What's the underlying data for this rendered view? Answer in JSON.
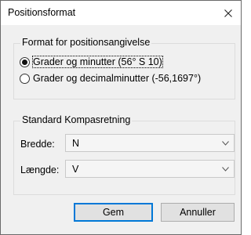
{
  "window": {
    "title": "Positionsformat",
    "close_icon": "close-icon"
  },
  "format_group": {
    "legend": "Format for positionsangivelse",
    "options": [
      {
        "label": "Grader og minutter (56° S 10)",
        "selected": true
      },
      {
        "label": "Grader og decimalminutter (-56,1697°)",
        "selected": false
      }
    ]
  },
  "compass_group": {
    "legend": "Standard Kompasretning",
    "latitude": {
      "label": "Bredde:",
      "value": "N"
    },
    "longitude": {
      "label": "Længde:",
      "value": "V"
    }
  },
  "buttons": {
    "save": "Gem",
    "cancel": "Annuller"
  },
  "colors": {
    "accent": "#0078d7",
    "dialog_bg": "#f0f0f0"
  }
}
